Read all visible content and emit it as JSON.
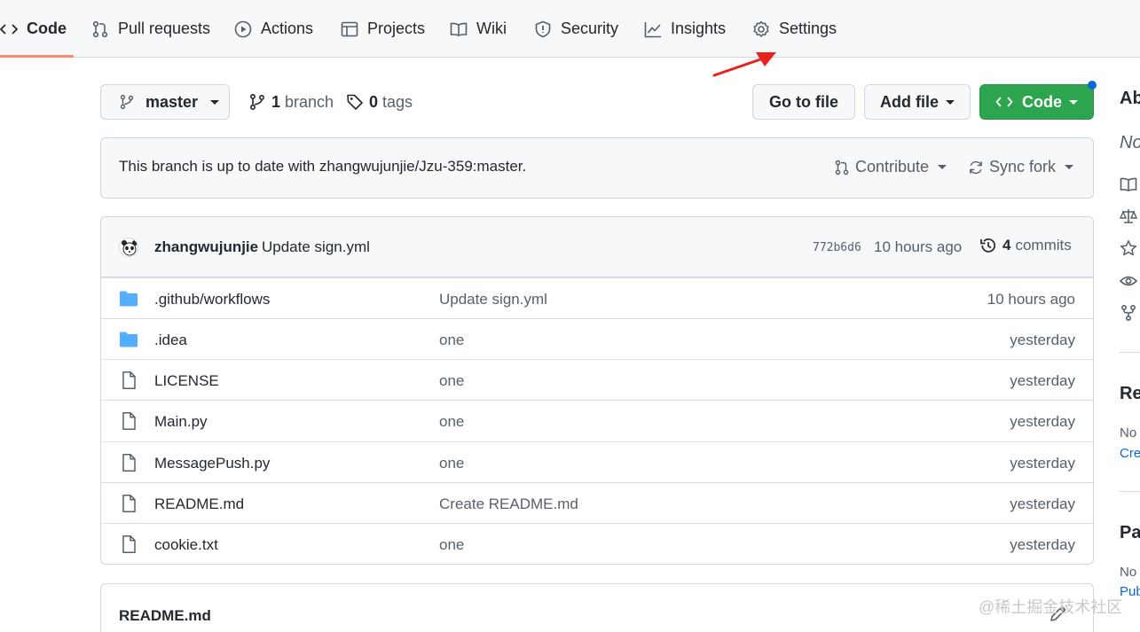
{
  "nav": {
    "tabs": [
      {
        "label": "Code"
      },
      {
        "label": "Pull requests"
      },
      {
        "label": "Actions"
      },
      {
        "label": "Projects"
      },
      {
        "label": "Wiki"
      },
      {
        "label": "Security"
      },
      {
        "label": "Insights"
      },
      {
        "label": "Settings"
      }
    ]
  },
  "toolbar": {
    "branch_select": "master",
    "branch_count": "1",
    "branch_label": "branch",
    "tag_count": "0",
    "tag_label": "tags",
    "go_to_file": "Go to file",
    "add_file": "Add file",
    "code": "Code"
  },
  "status": {
    "text": "This branch is up to date with zhangwujunjie/Jzu-359:master.",
    "contribute": "Contribute",
    "sync_fork": "Sync fork"
  },
  "commit": {
    "author": "zhangwujunjie",
    "message": "Update sign.yml",
    "sha": "772b6d6",
    "time": "10 hours ago",
    "count": "4",
    "count_label": "commits"
  },
  "files": [
    {
      "type": "folder",
      "name": ".github/workflows",
      "message": "Update sign.yml",
      "age": "10 hours ago"
    },
    {
      "type": "folder",
      "name": ".idea",
      "message": "one",
      "age": "yesterday"
    },
    {
      "type": "file",
      "name": "LICENSE",
      "message": "one",
      "age": "yesterday"
    },
    {
      "type": "file",
      "name": "Main.py",
      "message": "one",
      "age": "yesterday"
    },
    {
      "type": "file",
      "name": "MessagePush.py",
      "message": "one",
      "age": "yesterday"
    },
    {
      "type": "file",
      "name": "README.md",
      "message": "Create README.md",
      "age": "yesterday"
    },
    {
      "type": "file",
      "name": "cookie.txt",
      "message": "one",
      "age": "yesterday"
    }
  ],
  "readme": {
    "title": "README.md"
  },
  "sidebar": {
    "about_heading": "Ab",
    "about_desc": "No",
    "releases_heading": "Re",
    "releases_text": "No",
    "releases_link": "Cre",
    "packages_heading": "Pa",
    "packages_text": "No",
    "packages_link": "Pub"
  },
  "watermark": "@稀土掘金技术社区",
  "colors": {
    "accent": "#2da44e",
    "tab_underline": "#fd8c73",
    "link": "#0969da",
    "annotation_arrow": "#e8221b"
  }
}
